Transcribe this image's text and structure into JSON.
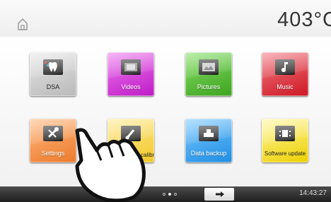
{
  "header": {
    "home_icon": "home-icon",
    "temperature": "403°C"
  },
  "tiles": [
    {
      "label": "DSA",
      "icon": "tooth-icon",
      "color": "#cfcfcf"
    },
    {
      "label": "Videos",
      "icon": "film-icon",
      "color": "#d94ddd"
    },
    {
      "label": "Pictures",
      "icon": "pictures-icon",
      "color": "#5dc03c"
    },
    {
      "label": "Music",
      "icon": "music-note-icon",
      "color": "#e4454f"
    },
    {
      "label": "Settings",
      "icon": "tools-icon",
      "color": "#f39a55"
    },
    {
      "label": "Temperature calibration",
      "icon": "temperature-icon",
      "color": "#f8dd68"
    },
    {
      "label": "Data backup",
      "icon": "usb-icon",
      "color": "#42a9f1"
    },
    {
      "label": "Software update",
      "icon": "chip-icon",
      "color": "#f4e230"
    }
  ],
  "footer": {
    "page_dots": 3,
    "active_dot": 2,
    "next_icon": "arrow-right-icon",
    "time": "14:43:27"
  }
}
